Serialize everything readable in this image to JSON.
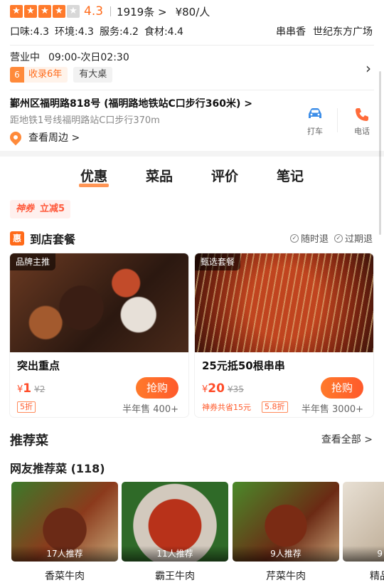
{
  "rating": {
    "stars_filled": 4,
    "stars_total": 5,
    "score": "4.3",
    "reviews": "1919条 >",
    "price": "¥80/人"
  },
  "subscores": [
    "口味:4.3",
    "环境:4.3",
    "服务:4.2",
    "食材:4.4"
  ],
  "tags": [
    "串串香",
    "世纪东方广场"
  ],
  "hours": {
    "label": "营业中",
    "time": "09:00-次日02:30",
    "badge_num": "6",
    "badge_years": "收录6年",
    "badge_table": "有大桌",
    "chevron": "›"
  },
  "address": {
    "line": "鄞州区福明路818号 (福明路地铁站C口步行360米) >",
    "metro": "距地铁1号线福明路站C口步行370m",
    "around": "查看周边 >"
  },
  "actions": {
    "taxi": "打车",
    "call": "电话"
  },
  "tabs": [
    "优惠",
    "菜品",
    "评价",
    "笔记"
  ],
  "coupon": {
    "brand": "神券",
    "text": "立减5"
  },
  "packages": {
    "icon": "惠",
    "title": "到店套餐",
    "flags": [
      "随时退",
      "过期退"
    ],
    "items": [
      {
        "ribbon": "品牌主推",
        "name": "突出重点",
        "currency": "¥",
        "price": "1",
        "old_price": "¥2",
        "buy": "抢购",
        "discount": "5折",
        "sales": "半年售 400+"
      },
      {
        "ribbon": "甄选套餐",
        "name": "25元抵50根串串",
        "currency": "¥",
        "price": "20",
        "old_price": "¥35",
        "buy": "抢购",
        "shared": "神券共省15元",
        "discount": "5.8折",
        "sales": "半年售 3000+"
      }
    ]
  },
  "recommend": {
    "title": "推荐菜",
    "all": "查看全部 >",
    "sub": "网友推荐菜 (118)",
    "dishes": [
      {
        "count": "17人推荐",
        "name": "香菜牛肉"
      },
      {
        "count": "11人推荐",
        "name": "霸王牛肉"
      },
      {
        "count": "9人推荐",
        "name": "芹菜牛肉"
      },
      {
        "count": "9",
        "name": "精品"
      }
    ]
  },
  "colors": {
    "accent": "#ff6b1a",
    "price_red": "#ff4d2a"
  }
}
